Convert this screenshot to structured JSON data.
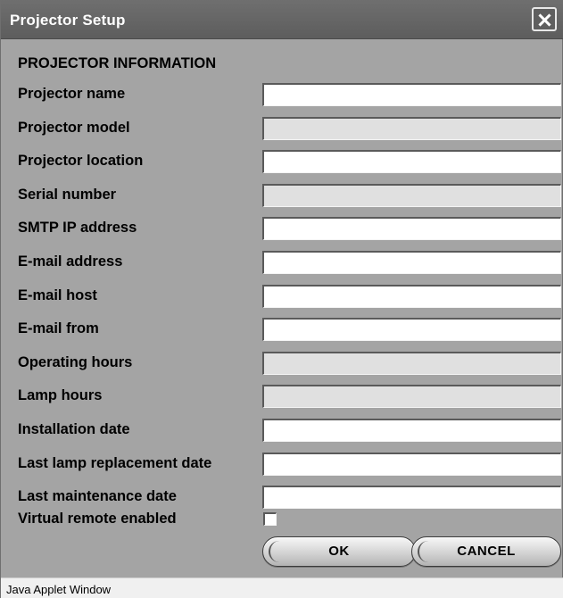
{
  "window": {
    "title": "Projector Setup"
  },
  "section_title": "PROJECTOR INFORMATION",
  "fields": [
    {
      "label": "Projector name",
      "value": "",
      "readonly": false
    },
    {
      "label": "Projector model",
      "value": "",
      "readonly": true
    },
    {
      "label": "Projector location",
      "value": "",
      "readonly": false
    },
    {
      "label": "Serial number",
      "value": "",
      "readonly": true
    },
    {
      "label": "SMTP IP address",
      "value": "",
      "readonly": false
    },
    {
      "label": "E-mail address",
      "value": "",
      "readonly": false
    },
    {
      "label": "E-mail host",
      "value": "",
      "readonly": false
    },
    {
      "label": "E-mail from",
      "value": "",
      "readonly": false
    },
    {
      "label": "Operating hours",
      "value": "",
      "readonly": true
    },
    {
      "label": "Lamp hours",
      "value": "",
      "readonly": true
    },
    {
      "label": "Installation date",
      "value": "",
      "readonly": false
    },
    {
      "label": "Last lamp replacement date",
      "value": "",
      "readonly": false
    },
    {
      "label": "Last maintenance date",
      "value": "",
      "readonly": false
    }
  ],
  "virtual_remote": {
    "label": "Virtual remote enabled",
    "checked": false
  },
  "buttons": {
    "ok": "OK",
    "cancel": "CANCEL"
  },
  "statusbar": {
    "text": "Java Applet Window"
  },
  "colors": {
    "titlebar": "#666666",
    "panel": "#a4a4a4",
    "readonly_field": "#e0e0e0"
  },
  "icons": {
    "close": "close-icon"
  }
}
